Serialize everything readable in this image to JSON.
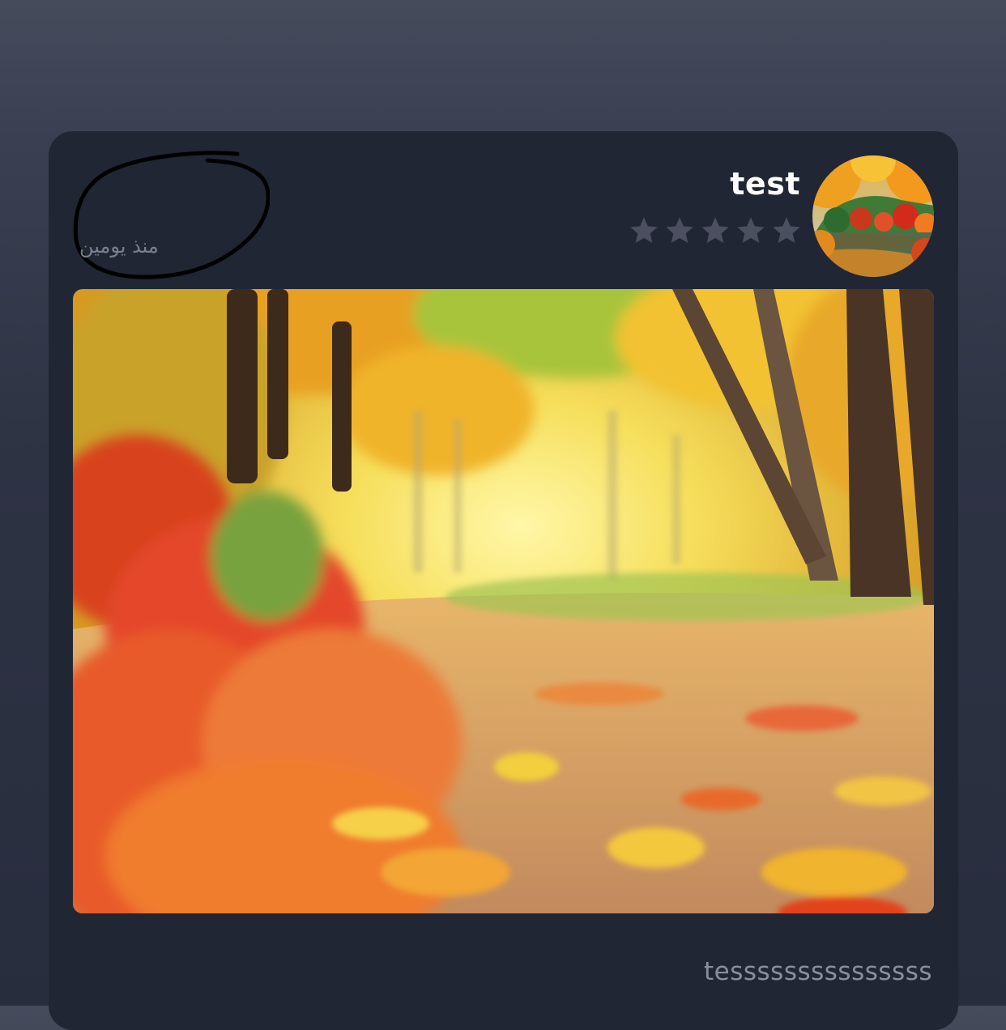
{
  "post": {
    "user_name": "test",
    "time_ago": "منذ يومين",
    "rating_stars": 0,
    "rating_max": 5,
    "caption": "tesssssssssssssss",
    "avatar_icon": "autumn-lake-photo",
    "image_icon": "autumn-forest-path-photo",
    "star_color_empty": "#4b4f60",
    "annotation_color": "#000000"
  }
}
